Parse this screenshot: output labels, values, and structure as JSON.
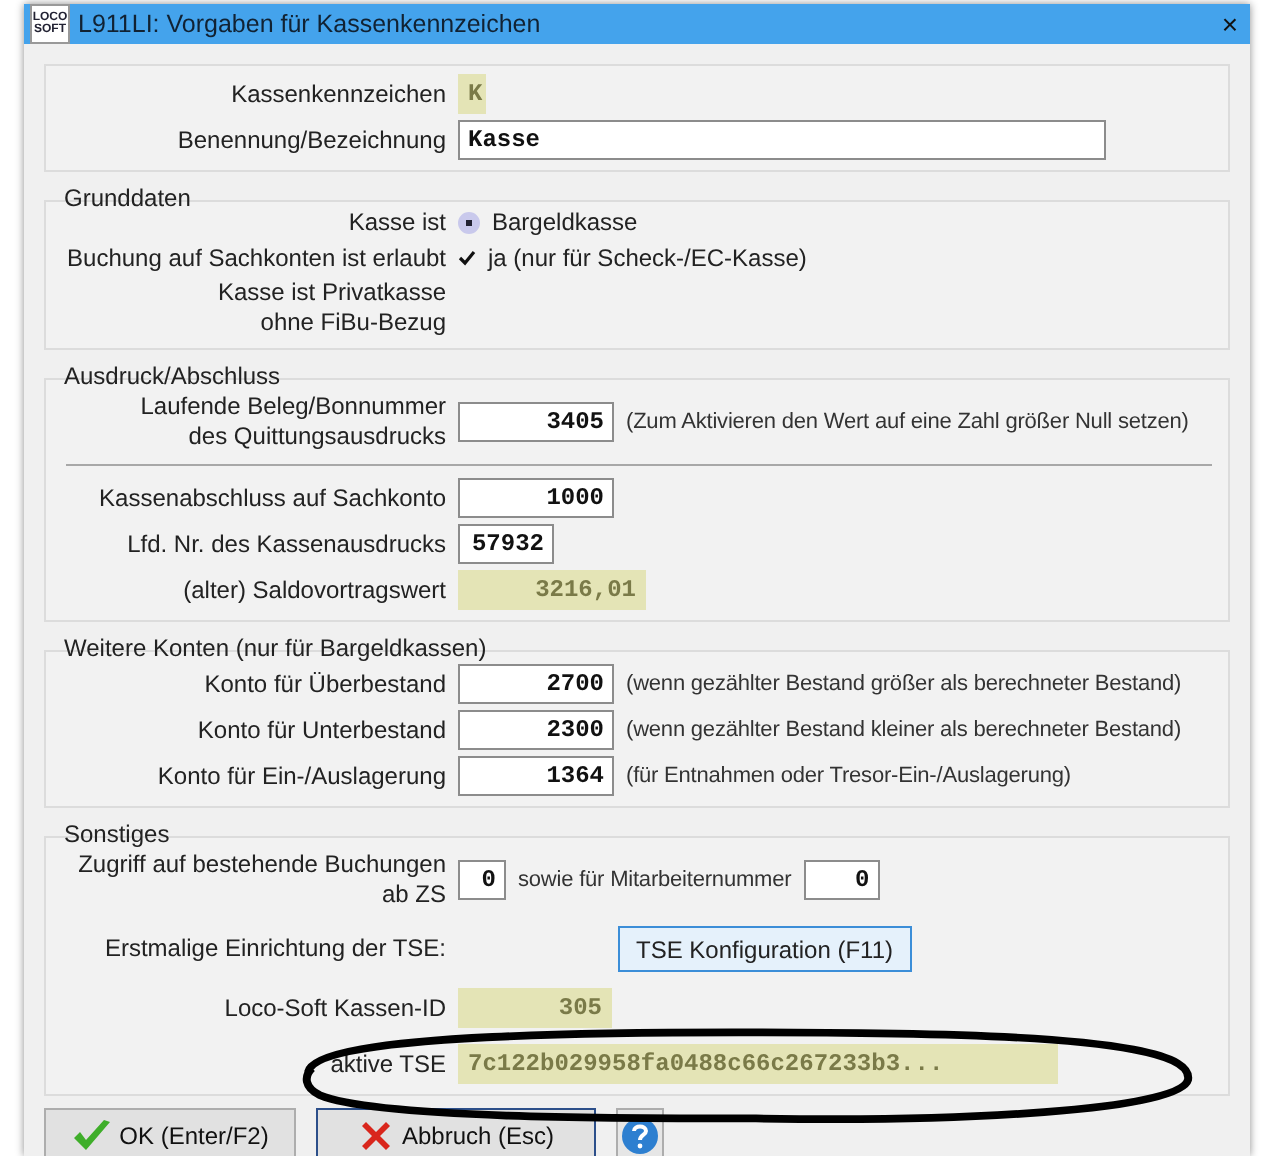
{
  "window": {
    "logo": [
      "LOCO",
      "SOFT"
    ],
    "title": "L911LI: Vorgaben für Kassenkennzeichen",
    "close": "×"
  },
  "sections": [
    {
      "rows": [
        {
          "label": [
            "Kassenkennzeichen"
          ],
          "items": [
            {
              "kind": "field",
              "value": "K",
              "readonly": true
            }
          ]
        },
        {
          "label": [
            "Benennung/Bezeichnung"
          ],
          "items": [
            {
              "kind": "field",
              "value": "Kasse",
              "readonly": false
            }
          ]
        }
      ]
    },
    {
      "legend": "Grunddaten",
      "rows": [
        {
          "label": [
            "Kasse ist"
          ],
          "items": [
            {
              "kind": "radio",
              "label": "Bargeldkasse",
              "selected": true
            }
          ]
        },
        {
          "label": [
            "Buchung auf Sachkonten ist erlaubt"
          ],
          "items": [
            {
              "kind": "checkbox",
              "label": "ja (nur für Scheck-/EC-Kasse)",
              "checked": true
            }
          ]
        },
        {
          "label": [
            "Kasse ist Privatkasse",
            "ohne FiBu-Bezug"
          ],
          "items": []
        }
      ]
    },
    {
      "legend": "Ausdruck/Abschluss",
      "rows": [
        {
          "label": [
            "Laufende Beleg/Bonnummer",
            "des Quittungsausdrucks"
          ],
          "items": [
            {
              "kind": "field",
              "value": "3405",
              "readonly": false
            },
            {
              "kind": "text",
              "text": "(Zum Aktivieren den Wert auf eine Zahl größer Null setzen)"
            }
          ]
        },
        {
          "label": [
            "Kassenabschluss auf Sachkonto"
          ],
          "items": [
            {
              "kind": "field",
              "value": "1000",
              "readonly": false
            }
          ]
        },
        {
          "label": [
            "Lfd. Nr. des Kassenausdrucks"
          ],
          "items": [
            {
              "kind": "field",
              "value": "57932",
              "readonly": false
            }
          ]
        },
        {
          "label": [
            "(alter) Saldovortragswert"
          ],
          "items": [
            {
              "kind": "field",
              "value": "3216,01",
              "readonly": true
            }
          ]
        }
      ]
    },
    {
      "legend": "Weitere Konten (nur für Bargeldkassen)",
      "rows": [
        {
          "label": [
            "Konto für Überbestand"
          ],
          "items": [
            {
              "kind": "field",
              "value": "2700",
              "readonly": false
            },
            {
              "kind": "text",
              "text": "(wenn gezählter Bestand größer als berechneter Bestand)"
            }
          ]
        },
        {
          "label": [
            "Konto für Unterbestand"
          ],
          "items": [
            {
              "kind": "field",
              "value": "2300",
              "readonly": false
            },
            {
              "kind": "text",
              "text": "(wenn gezählter Bestand kleiner als berechneter Bestand)"
            }
          ]
        },
        {
          "label": [
            "Konto für Ein-/Auslagerung"
          ],
          "items": [
            {
              "kind": "field",
              "value": "1364",
              "readonly": false
            },
            {
              "kind": "text",
              "text": "(für Entnahmen oder Tresor-Ein-/Auslagerung)"
            }
          ]
        }
      ]
    },
    {
      "legend": "Sonstiges",
      "rows": [
        {
          "label": [
            "Zugriff auf bestehende Buchungen",
            "ab ZS"
          ],
          "items": [
            {
              "kind": "field",
              "value": "0",
              "readonly": false
            },
            {
              "kind": "text",
              "text": "sowie für Mitarbeiternummer"
            },
            {
              "kind": "field",
              "value": "0",
              "readonly": false
            }
          ]
        },
        {
          "label": [
            "Erstmalige Einrichtung der TSE:"
          ],
          "items": [
            {
              "kind": "button",
              "label": "TSE Konfiguration (F11)"
            }
          ]
        },
        {
          "label": [
            "Loco-Soft Kassen-ID"
          ],
          "items": [
            {
              "kind": "field",
              "value": "305",
              "readonly": true
            }
          ]
        },
        {
          "label": [
            "aktive TSE"
          ],
          "items": [
            {
              "kind": "field",
              "value": "7c122b029958fa0488c66c267233b3...",
              "readonly": true
            }
          ]
        }
      ]
    }
  ],
  "footer": [
    {
      "kind": "ok",
      "label": "OK (Enter/F2)",
      "focused": false
    },
    {
      "kind": "cancel",
      "label": "Abbruch (Esc)",
      "focused": true
    },
    {
      "kind": "help"
    }
  ]
}
